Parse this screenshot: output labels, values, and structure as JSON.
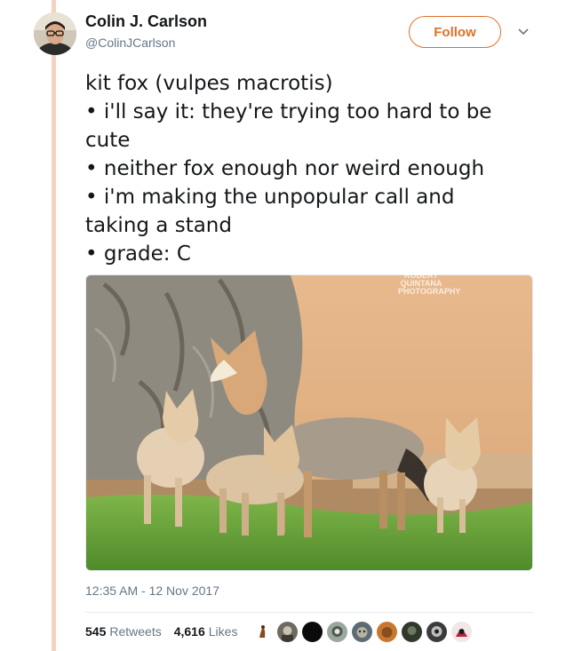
{
  "author": {
    "name": "Colin J. Carlson",
    "handle": "@ColinJCarlson"
  },
  "follow_label": "Follow",
  "tweet_lines": [
    "kit fox (vulpes macrotis)",
    "• i'll say it: they're trying too hard to be",
    "cute",
    "• neither fox enough nor weird enough",
    "• i'm making the unpopular call and",
    "taking a stand",
    "• grade: C"
  ],
  "photo": {
    "watermark_lines": [
      "ROBERT",
      "QUINTANA",
      "PHOTOGRAPHY"
    ]
  },
  "timestamp": "12:35 AM - 12 Nov 2017",
  "stats": {
    "retweets_count": "545",
    "retweets_label": "Retweets",
    "likes_count": "4,616",
    "likes_label": "Likes"
  },
  "colors": {
    "accent": "#e0702a",
    "thread_line": "#f5d2bf",
    "secondary_text": "#657786"
  }
}
